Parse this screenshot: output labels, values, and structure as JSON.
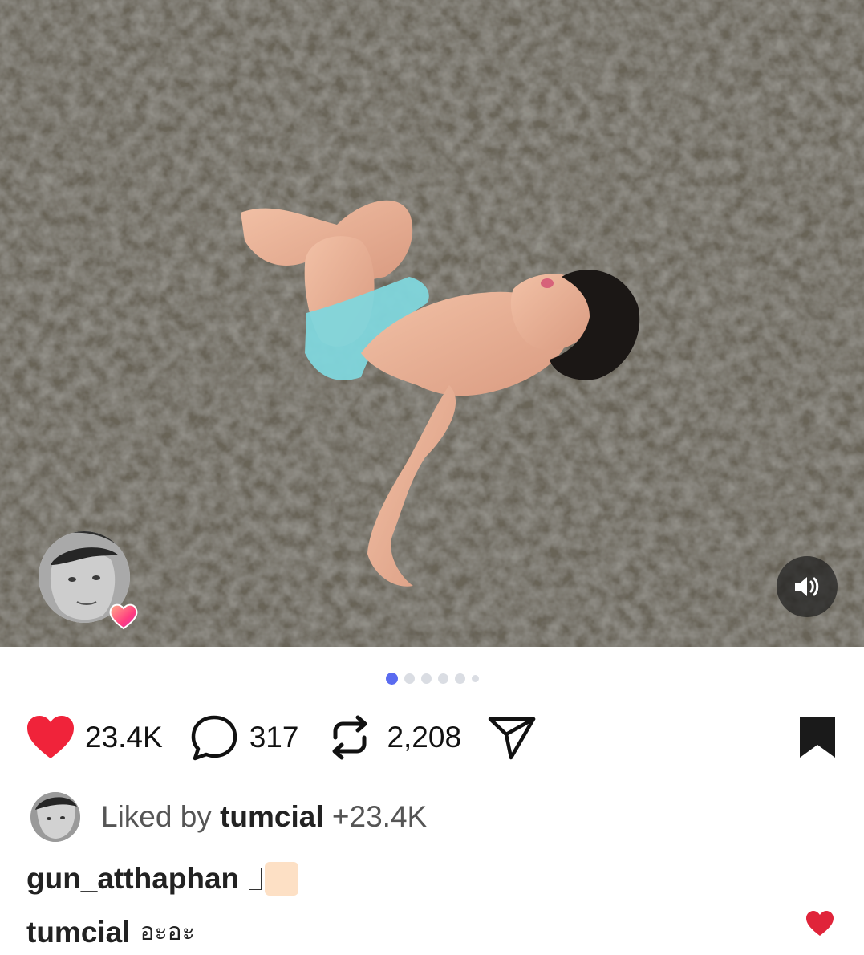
{
  "media": {
    "description_icon": "photo",
    "carousel": {
      "total": 6,
      "active_index": 0
    },
    "sound_icon": "speaker-icon"
  },
  "actions": {
    "likes": "23.4K",
    "comments": "317",
    "reposts": "2,208",
    "like_icon": "heart-filled-icon",
    "comment_icon": "comment-bubble-icon",
    "repost_icon": "repost-icon",
    "share_icon": "send-icon",
    "bookmark_icon": "bookmark-filled-icon",
    "like_color": "#f0233a"
  },
  "liked_by": {
    "prefix": "Liked by ",
    "user": "tumcial",
    "suffix": " +23.4K"
  },
  "caption": {
    "user": "gun_atthaphan"
  },
  "top_comment": {
    "user": "tumcial",
    "text": "อะอะ",
    "heart_color": "#e0243a"
  },
  "accent": "#5a6bf0"
}
